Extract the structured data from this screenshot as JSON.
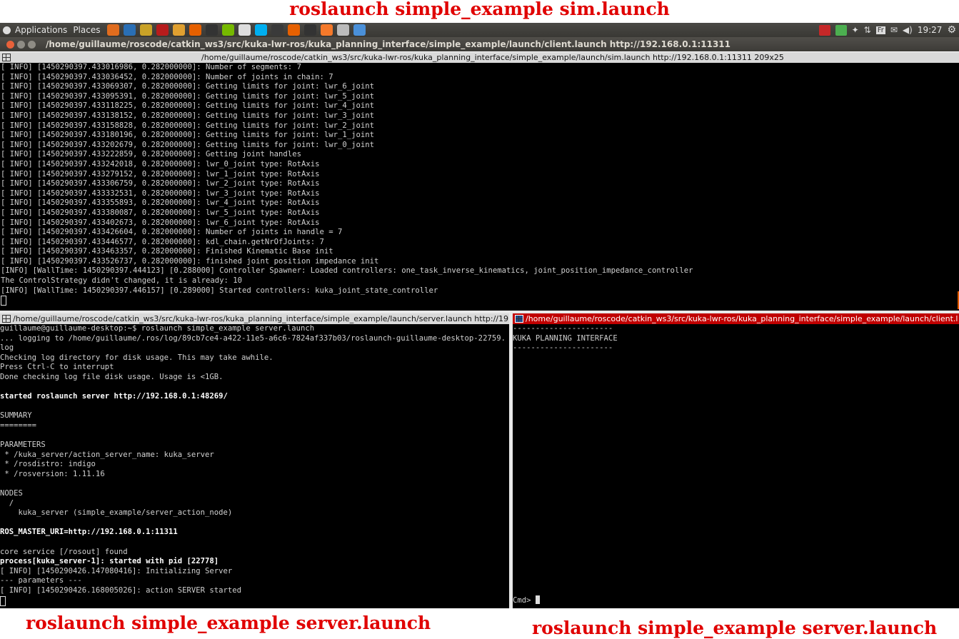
{
  "captions": {
    "top": "roslaunch simple_example sim.launch",
    "bottom_left": "roslaunch simple_example server.launch",
    "bottom_right": "roslaunch simple_example server.launch"
  },
  "panel": {
    "applications": "Applications",
    "places": "Places",
    "tray_keyboard": "Fr",
    "clock": "19:27",
    "launcher_icons": [
      "folder-icon",
      "network-icon",
      "files-icon",
      "terminal-red-icon",
      "kite-icon",
      "firefox-icon",
      "terminal-icon",
      "nvidia-icon",
      "text-editor-icon",
      "skype-icon",
      "system-monitor-icon",
      "firefox-icon",
      "terminal-icon",
      "blender-icon",
      "settings-icon",
      "code-icon"
    ],
    "tray_icons": [
      "filezilla-icon",
      "check-icon",
      "dropbox-icon",
      "network-arrows-icon",
      "keyboard-icon",
      "mail-icon",
      "volume-icon",
      "gear-icon"
    ]
  },
  "window": {
    "title": "/home/guillaume/roscode/catkin_ws3/src/kuka-lwr-ros/kuka_planning_interface/simple_example/launch/client.launch http://192.168.0.1:11311"
  },
  "top_pane": {
    "title": "/home/guillaume/roscode/catkin_ws3/src/kuka-lwr-ros/kuka_planning_interface/simple_example/launch/sim.launch http://192.168.0.1:11311 209x25",
    "lines": [
      "[ INFO] [1450290397.433016986, 0.282000000]: Number of segments: 7",
      "[ INFO] [1450290397.433036452, 0.282000000]: Number of joints in chain: 7",
      "[ INFO] [1450290397.433069307, 0.282000000]: Getting limits for joint: lwr_6_joint",
      "[ INFO] [1450290397.433095391, 0.282000000]: Getting limits for joint: lwr_5_joint",
      "[ INFO] [1450290397.433118225, 0.282000000]: Getting limits for joint: lwr_4_joint",
      "[ INFO] [1450290397.433138152, 0.282000000]: Getting limits for joint: lwr_3_joint",
      "[ INFO] [1450290397.433158828, 0.282000000]: Getting limits for joint: lwr_2_joint",
      "[ INFO] [1450290397.433180196, 0.282000000]: Getting limits for joint: lwr_1_joint",
      "[ INFO] [1450290397.433202679, 0.282000000]: Getting limits for joint: lwr_0_joint",
      "[ INFO] [1450290397.433222859, 0.282000000]: Getting joint handles",
      "[ INFO] [1450290397.433242018, 0.282000000]: lwr_0_joint type: RotAxis",
      "[ INFO] [1450290397.433279152, 0.282000000]: lwr_1_joint type: RotAxis",
      "[ INFO] [1450290397.433306759, 0.282000000]: lwr_2_joint type: RotAxis",
      "[ INFO] [1450290397.433332531, 0.282000000]: lwr_3_joint type: RotAxis",
      "[ INFO] [1450290397.433355893, 0.282000000]: lwr_4_joint type: RotAxis",
      "[ INFO] [1450290397.433380087, 0.282000000]: lwr_5_joint type: RotAxis",
      "[ INFO] [1450290397.433402673, 0.282000000]: lwr_6_joint type: RotAxis",
      "[ INFO] [1450290397.433426604, 0.282000000]: Number of joints in handle = 7",
      "[ INFO] [1450290397.433446577, 0.282000000]: kdl_chain.getNrOfJoints: 7",
      "[ INFO] [1450290397.433463357, 0.282000000]: Finished Kinematic Base init",
      "[ INFO] [1450290397.433526737, 0.282000000]: finished joint position impedance init",
      "[INFO] [WallTime: 1450290397.444123] [0.288000] Controller Spawner: Loaded controllers: one_task_inverse_kinematics, joint_position_impedance_controller",
      "The ControlStrategy didn't changed, it is already: 10",
      "[INFO] [WallTime: 1450290397.446157] [0.289000] Started controllers: kuka_joint_state_controller"
    ]
  },
  "bottom_left_pane": {
    "title": "/home/guillaume/roscode/catkin_ws3/src/kuka-lwr-ros/kuka_planning_interface/simple_example/launch/server.launch http://19:",
    "lines": [
      {
        "t": "guillaume@guillaume-desktop:~$ roslaunch simple_example server.launch",
        "b": false
      },
      {
        "t": "... logging to /home/guillaume/.ros/log/89cb7ce4-a422-11e5-a6c6-7824af337b03/roslaunch-guillaume-desktop-22759.",
        "b": false
      },
      {
        "t": "log",
        "b": false
      },
      {
        "t": "Checking log directory for disk usage. This may take awhile.",
        "b": false
      },
      {
        "t": "Press Ctrl-C to interrupt",
        "b": false
      },
      {
        "t": "Done checking log file disk usage. Usage is <1GB.",
        "b": false
      },
      {
        "t": "",
        "b": false
      },
      {
        "t": "started roslaunch server http://192.168.0.1:48269/",
        "b": true
      },
      {
        "t": "",
        "b": false
      },
      {
        "t": "SUMMARY",
        "b": false
      },
      {
        "t": "========",
        "b": false
      },
      {
        "t": "",
        "b": false
      },
      {
        "t": "PARAMETERS",
        "b": false
      },
      {
        "t": " * /kuka_server/action_server_name: kuka_server",
        "b": false
      },
      {
        "t": " * /rosdistro: indigo",
        "b": false
      },
      {
        "t": " * /rosversion: 1.11.16",
        "b": false
      },
      {
        "t": "",
        "b": false
      },
      {
        "t": "NODES",
        "b": false
      },
      {
        "t": "  /",
        "b": false
      },
      {
        "t": "    kuka_server (simple_example/server_action_node)",
        "b": false
      },
      {
        "t": "",
        "b": false
      },
      {
        "t": "ROS_MASTER_URI=http://192.168.0.1:11311",
        "b": true
      },
      {
        "t": "",
        "b": false
      },
      {
        "t": "core service [/rosout] found",
        "b": false
      },
      {
        "t": "process[kuka_server-1]: started with pid [22778]",
        "b": true
      },
      {
        "t": "[ INFO] [1450290426.147080416]: Initializing Server",
        "b": false
      },
      {
        "t": "--- parameters ---",
        "b": false
      },
      {
        "t": "[ INFO] [1450290426.168005026]: action SERVER started",
        "b": false
      }
    ]
  },
  "bottom_right_pane": {
    "title": "/home/guillaume/roscode/catkin_ws3/src/kuka-lwr-ros/kuka_planning_interface/simple_example/launch/client.l",
    "lines": [
      "----------------------",
      "KUKA PLANNING INTERFACE",
      "----------------------"
    ],
    "prompt": "Cmd> "
  }
}
